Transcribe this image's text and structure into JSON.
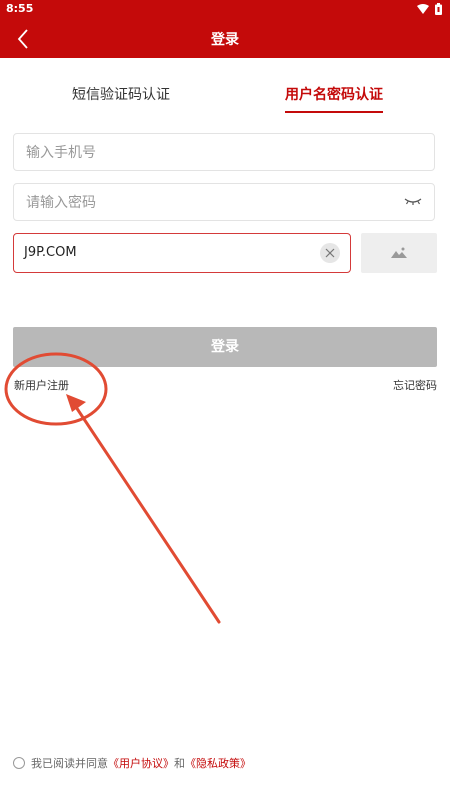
{
  "status_bar": {
    "time": "8:55"
  },
  "header": {
    "title": "登录"
  },
  "tabs": [
    {
      "label": "短信验证码认证",
      "active": false
    },
    {
      "label": "用户名密码认证",
      "active": true
    }
  ],
  "form": {
    "phone_placeholder": "输入手机号",
    "password_placeholder": "请输入密码",
    "captcha_value": "J9P.COM"
  },
  "buttons": {
    "login": "登录"
  },
  "links": {
    "register": "新用户注册",
    "forgot": "忘记密码"
  },
  "agreement": {
    "prefix": "我已阅读并同意",
    "user_agreement": "《用户协议》",
    "and": "和",
    "privacy_policy": "《隐私政策》"
  },
  "colors": {
    "brand": "#c40a0a",
    "annotation": "#e14b33",
    "disabled_button": "#b8b8b8"
  }
}
